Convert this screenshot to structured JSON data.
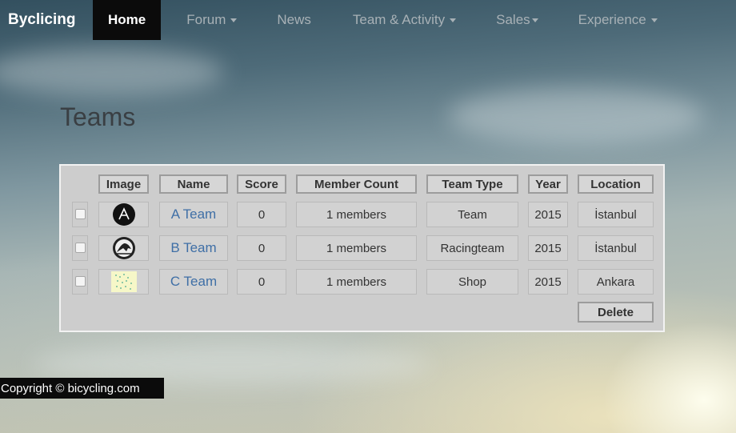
{
  "navbar": {
    "brand": "Byclicing",
    "items": [
      {
        "label": "Home",
        "active": true,
        "dropdown": false
      },
      {
        "label": "Forum",
        "active": false,
        "dropdown": true
      },
      {
        "label": "News",
        "active": false,
        "dropdown": false
      },
      {
        "label": "Team & Activity",
        "active": false,
        "dropdown": true
      },
      {
        "label": "Sales",
        "active": false,
        "dropdown": true
      },
      {
        "label": "Experience",
        "active": false,
        "dropdown": true
      }
    ]
  },
  "page": {
    "title": "Teams"
  },
  "table": {
    "headers": [
      "Image",
      "Name",
      "Score",
      "Member Count",
      "Team Type",
      "Year",
      "Location"
    ],
    "rows": [
      {
        "image": "a-team-logo",
        "name": "A Team",
        "score": "0",
        "members": "1 members",
        "type": "Team",
        "year": "2015",
        "location": "İstanbul"
      },
      {
        "image": "b-team-logo",
        "name": "B Team",
        "score": "0",
        "members": "1 members",
        "type": "Racingteam",
        "year": "2015",
        "location": "İstanbul"
      },
      {
        "image": "c-team-logo",
        "name": "C Team",
        "score": "0",
        "members": "1 members",
        "type": "Shop",
        "year": "2015",
        "location": "Ankara"
      }
    ],
    "delete_label": "Delete"
  },
  "footer": {
    "copyright": "Copyright © bicycling.com"
  },
  "colors": {
    "link": "#3f6fa6",
    "nav_active_bg": "#0b0b0b",
    "nav_text": "#a8b1b6"
  }
}
